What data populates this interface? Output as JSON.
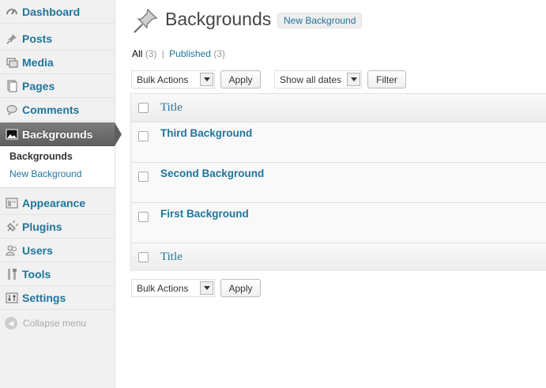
{
  "sidebar": {
    "items": [
      {
        "label": "Dashboard",
        "icon": "dashboard-icon"
      },
      {
        "label": "Posts",
        "icon": "pin-icon"
      },
      {
        "label": "Media",
        "icon": "media-icon"
      },
      {
        "label": "Pages",
        "icon": "pages-icon"
      },
      {
        "label": "Comments",
        "icon": "comment-icon"
      },
      {
        "label": "Backgrounds",
        "icon": "image-icon"
      },
      {
        "label": "Appearance",
        "icon": "appearance-icon"
      },
      {
        "label": "Plugins",
        "icon": "plugin-icon"
      },
      {
        "label": "Users",
        "icon": "users-icon"
      },
      {
        "label": "Tools",
        "icon": "tools-icon"
      },
      {
        "label": "Settings",
        "icon": "settings-icon"
      }
    ],
    "submenu": {
      "current": "Backgrounds",
      "other": "New Background"
    },
    "collapse_label": "Collapse menu"
  },
  "header": {
    "title": "Backgrounds",
    "add_new_label": "New Background"
  },
  "filters": {
    "all_label": "All",
    "all_count": "(3)",
    "separator": "|",
    "published_label": "Published",
    "published_count": "(3)"
  },
  "top_actions": {
    "bulk_actions": "Bulk Actions",
    "apply": "Apply",
    "dates": "Show all dates",
    "filter": "Filter"
  },
  "bottom_actions": {
    "bulk_actions": "Bulk Actions",
    "apply": "Apply"
  },
  "table": {
    "column_title": "Title",
    "rows": [
      {
        "title": "Third Background"
      },
      {
        "title": "Second Background"
      },
      {
        "title": "First Background"
      }
    ]
  },
  "colors": {
    "link": "#21759b",
    "active_menu": "#6d6d6d",
    "sidebar_bg": "#f1f1f1"
  }
}
